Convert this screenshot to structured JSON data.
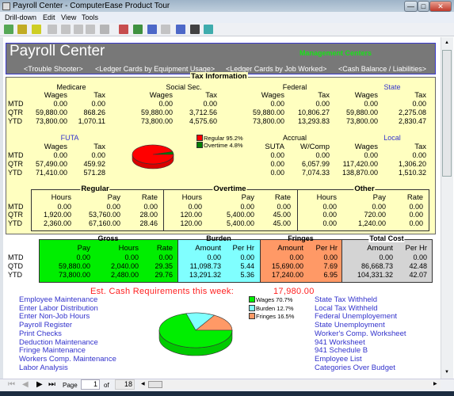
{
  "window": {
    "title": "Payroll Center - ComputerEase Product Tour",
    "minimize": "—",
    "maximize": "□",
    "close": "✕"
  },
  "menu": [
    "Drill-down",
    "Edit",
    "View",
    "Tools"
  ],
  "toolbar_icons": [
    "refresh-icon",
    "document-icon",
    "open-tray-icon",
    "zoom-icon",
    "find-icon",
    "export-icon",
    "edit-icon",
    "factory-icon",
    "report-icon",
    "grid-icon",
    "drilldown-icon",
    "copy-icon",
    "home-icon",
    "navigate-icon",
    "calculator-icon"
  ],
  "header": {
    "title": "Payroll Center",
    "management": "Management Centers",
    "links": [
      "<Trouble Shooter>",
      "<Ledger Cards by Equipment Usage>",
      "<Ledger Cards by Job Worked>",
      "<Cash Balance / Liabilities>"
    ]
  },
  "row_labels": [
    "MTD",
    "QTR",
    "YTD"
  ],
  "tax": {
    "title": "Tax Information",
    "medicare": {
      "label": "Medicare",
      "headers": [
        "Wages",
        "Tax"
      ],
      "rows": [
        [
          "0.00",
          "0.00"
        ],
        [
          "59,880.00",
          "868.26"
        ],
        [
          "73,800.00",
          "1,070.11"
        ]
      ]
    },
    "social": {
      "label": "Social Sec.",
      "headers": [
        "Wages",
        "Tax"
      ],
      "rows": [
        [
          "0.00",
          "0.00"
        ],
        [
          "59,880.00",
          "3,712.56"
        ],
        [
          "73,800.00",
          "4,575.60"
        ]
      ]
    },
    "federal": {
      "label": "Federal",
      "headers": [
        "Wages",
        "Tax"
      ],
      "rows": [
        [
          "0.00",
          "0.00"
        ],
        [
          "59,880.00",
          "10,806.27"
        ],
        [
          "73,800.00",
          "13,293.83"
        ]
      ]
    },
    "state": {
      "label": "State",
      "headers": [
        "Wages",
        "Tax"
      ],
      "rows": [
        [
          "0.00",
          "0.00"
        ],
        [
          "59,880.00",
          "2,275.08"
        ],
        [
          "73,800.00",
          "2,830.47"
        ]
      ]
    },
    "futa": {
      "label": "FUTA",
      "headers": [
        "Wages",
        "Tax"
      ],
      "rows": [
        [
          "0.00",
          "0.00"
        ],
        [
          "57,490.00",
          "459.92"
        ],
        [
          "71,410.00",
          "571.28"
        ]
      ]
    },
    "accrual": {
      "label": "Accrual",
      "headers": [
        "SUTA",
        "W/Comp"
      ],
      "rows": [
        [
          "0.00",
          "0.00"
        ],
        [
          "0.00",
          "6,057.99"
        ],
        [
          "0.00",
          "7,074.33"
        ]
      ]
    },
    "local": {
      "label": "Local",
      "headers": [
        "Wages",
        "Tax"
      ],
      "rows": [
        [
          "0.00",
          "0.00"
        ],
        [
          "117,420.00",
          "1,306.20"
        ],
        [
          "138,870.00",
          "1,510.32"
        ]
      ]
    }
  },
  "pay_pie": {
    "slices": [
      {
        "label": "Regular 95.2%",
        "value": 95.2,
        "color": "#ff0000"
      },
      {
        "label": "Overtime 4.8%",
        "value": 4.8,
        "color": "#008000"
      }
    ]
  },
  "hours": {
    "regular": {
      "label": "Regular",
      "headers": [
        "Hours",
        "Pay",
        "Rate"
      ],
      "rows": [
        [
          "0.00",
          "0.00",
          "0.00"
        ],
        [
          "1,920.00",
          "53,760.00",
          "28.00"
        ],
        [
          "2,360.00",
          "67,160.00",
          "28.46"
        ]
      ]
    },
    "overtime": {
      "label": "Overtime",
      "headers": [
        "Hours",
        "Pay",
        "Rate"
      ],
      "rows": [
        [
          "0.00",
          "0.00",
          "0.00"
        ],
        [
          "120.00",
          "5,400.00",
          "45.00"
        ],
        [
          "120.00",
          "5,400.00",
          "45.00"
        ]
      ]
    },
    "other": {
      "label": "Other",
      "headers": [
        "Hours",
        "Pay",
        "Rate"
      ],
      "rows": [
        [
          "0.00",
          "0.00",
          "0.00"
        ],
        [
          "0.00",
          "720.00",
          "0.00"
        ],
        [
          "0.00",
          "1,240.00",
          "0.00"
        ]
      ]
    }
  },
  "cost_row_labels": [
    "MTD",
    "QTD",
    "YTD"
  ],
  "cost": {
    "gross": {
      "label": "Gross",
      "color": "#00ee00",
      "headers": [
        "Pay",
        "Hours",
        "Rate"
      ],
      "rows": [
        [
          "0.00",
          "0.00",
          "0.00"
        ],
        [
          "59,880.00",
          "2,040.00",
          "29.35"
        ],
        [
          "73,800.00",
          "2,480.00",
          "29.76"
        ]
      ]
    },
    "burden": {
      "label": "Burden",
      "color": "#80ffff",
      "headers": [
        "Amount",
        "Per Hr"
      ],
      "rows": [
        [
          "0.00",
          "0.00"
        ],
        [
          "11,098.73",
          "5.44"
        ],
        [
          "13,291.32",
          "5.36"
        ]
      ]
    },
    "fringes": {
      "label": "Fringes",
      "color": "#ff9966",
      "headers": [
        "Amount",
        "Per Hr"
      ],
      "rows": [
        [
          "0.00",
          "0.00"
        ],
        [
          "15,690.00",
          "7.69"
        ],
        [
          "17,240.00",
          "6.95"
        ]
      ]
    },
    "total": {
      "label": "Total Cost",
      "color": "#d4d4d4",
      "headers": [
        "Amount",
        "Per Hr"
      ],
      "rows": [
        [
          "0.00",
          "0.00"
        ],
        [
          "86,668.73",
          "42.48"
        ],
        [
          "104,331.32",
          "42.07"
        ]
      ]
    }
  },
  "cash": {
    "label": "Est. Cash Requirements this week:",
    "value": "17,980.00"
  },
  "cost_pie": {
    "slices": [
      {
        "label": "Wages 70.7%",
        "value": 70.7,
        "color": "#00ee00"
      },
      {
        "label": "Burden 12.7%",
        "value": 12.7,
        "color": "#80ffff"
      },
      {
        "label": "Fringes 16.5%",
        "value": 16.5,
        "color": "#ff9966"
      }
    ]
  },
  "links_left": [
    "Employee Maintenance",
    "Enter Labor Distribution",
    "Enter Non-Job Hours",
    "Payroll Register",
    "Print Checks",
    "Deduction Maintenance",
    "Fringe Maintenance",
    "Workers Comp. Maintenance",
    "Labor Analysis"
  ],
  "links_right": [
    "State Tax Withheld",
    "Local Tax Withheld",
    "Federal Unemployement",
    "State Unemployment",
    "Worker's Comp. Worksheet",
    "941 Worksheet",
    "941 Schedule B",
    "Employee List",
    "Categories Over Budget"
  ],
  "nav": {
    "page_label": "Page",
    "page": "1",
    "of_label": "of",
    "total": "18"
  }
}
